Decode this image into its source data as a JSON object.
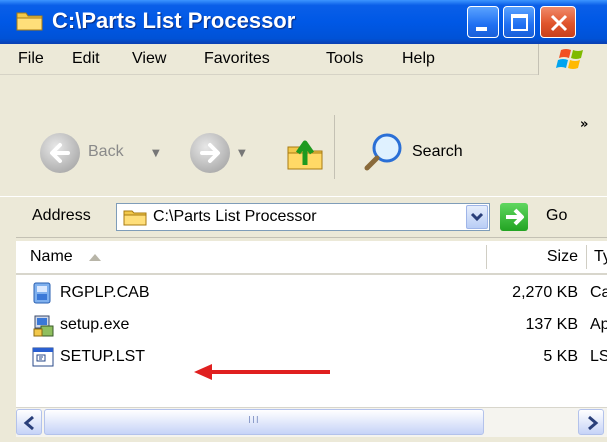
{
  "window": {
    "title": "C:\\Parts List Processor"
  },
  "menu": [
    "File",
    "Edit",
    "View",
    "Favorites",
    "Tools",
    "Help"
  ],
  "toolbar": {
    "back_label": "Back",
    "search_label": "Search",
    "more": "»"
  },
  "address": {
    "label": "Address",
    "value": "C:\\Parts List Processor",
    "go_label": "Go"
  },
  "columns": {
    "name": "Name",
    "size": "Size",
    "type": "Ty"
  },
  "files": [
    {
      "name": "RGPLP.CAB",
      "size": "2,270 KB",
      "type": "Ca",
      "icon": "cab-file-icon"
    },
    {
      "name": "setup.exe",
      "size": "137 KB",
      "type": "Ap",
      "icon": "setup-exe-icon"
    },
    {
      "name": "SETUP.LST",
      "size": "5 KB",
      "type": "LS",
      "icon": "lst-file-icon"
    }
  ],
  "scrollbar": {
    "grip": "III"
  },
  "colors": {
    "title_bar": "#0058e6",
    "frame": "#ece9d8",
    "arrow": "#e02020",
    "close_button": "#e0552c",
    "go_button": "#23a323"
  }
}
